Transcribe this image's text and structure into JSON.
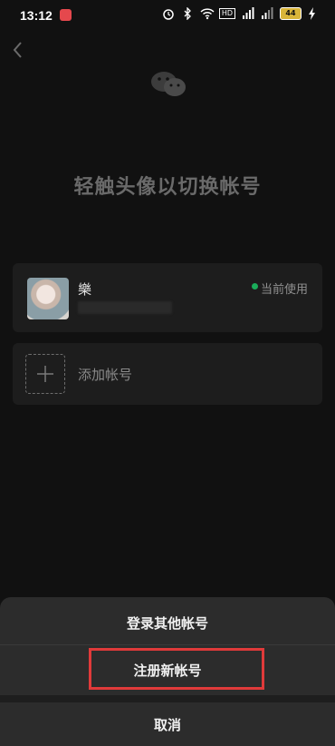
{
  "status_bar": {
    "time": "13:12",
    "battery": "44",
    "network_badge": "HD"
  },
  "header": {
    "title": "轻触头像以切换帐号"
  },
  "accounts": [
    {
      "name": "樂",
      "status": "当前使用"
    }
  ],
  "add_account": {
    "label": "添加帐号"
  },
  "action_sheet": {
    "login_other": "登录其他帐号",
    "register_new": "注册新帐号",
    "cancel": "取消"
  },
  "colors": {
    "accent_green": "#1aad5a",
    "highlight_red": "#e03a3a"
  },
  "icons": [
    "back-arrow-icon",
    "wechat-logo-icon",
    "plus-icon"
  ]
}
